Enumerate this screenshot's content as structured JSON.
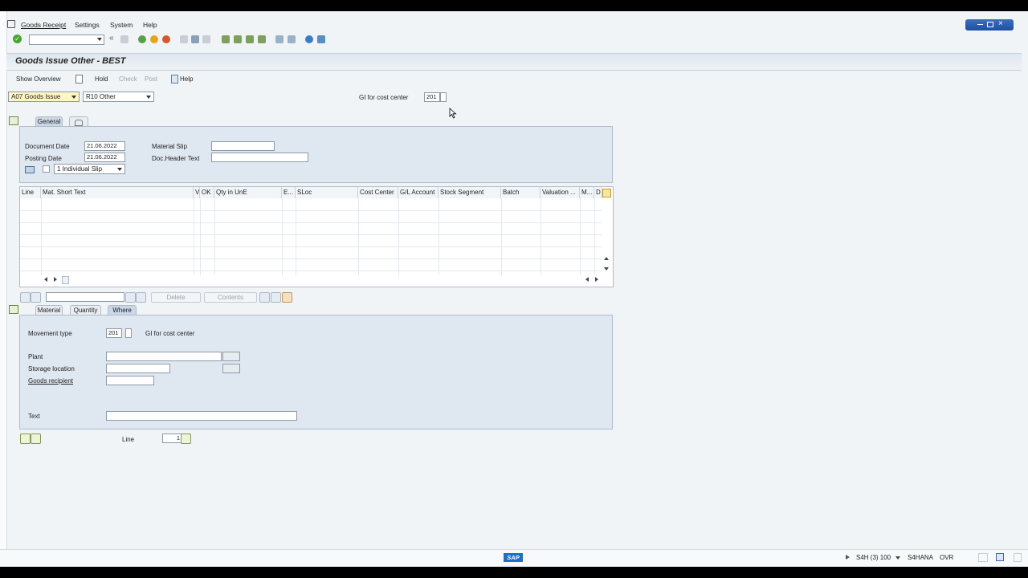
{
  "menu": {
    "items": [
      "Goods Receipt",
      "Settings",
      "System",
      "Help"
    ]
  },
  "title": "Goods Issue Other - BEST",
  "app_toolbar": {
    "show_overview": "Show Overview",
    "hold": "Hold",
    "check": "Check",
    "post": "Post",
    "help": "Help"
  },
  "header": {
    "action": "A07 Goods Issue",
    "reference": "R10 Other",
    "movement_label": "GI for cost center",
    "movement_value": "201"
  },
  "tabs_top": [
    "General"
  ],
  "general": {
    "document_date_label": "Document Date",
    "document_date": "21.06.2022",
    "posting_date_label": "Posting Date",
    "posting_date": "21.06.2022",
    "material_slip_label": "Material Slip",
    "doc_header_label": "Doc.Header Text",
    "slip_option": "1 Individual Slip"
  },
  "grid": {
    "columns": [
      "Line",
      "Mat. Short Text",
      "V",
      "OK",
      "Qty in UnE",
      "E...",
      "SLoc",
      "Cost Center",
      "G/L Account",
      "Stock Segment",
      "Batch",
      "Valuation ...",
      "M...",
      "D"
    ]
  },
  "grid_toolbar": {
    "delete": "Delete",
    "contents": "Contents"
  },
  "tabs_bottom": [
    "Material",
    "Quantity",
    "Where"
  ],
  "where": {
    "movement_type_label": "Movement type",
    "movement_type_value": "201",
    "movement_type_text": "GI for cost center",
    "plant_label": "Plant",
    "storage_label": "Storage location",
    "recipient_label": "Goods recipient",
    "text_label": "Text"
  },
  "footer": {
    "line_label": "Line",
    "line_value": "1"
  },
  "status": {
    "logo": "SAP",
    "system": "S4H (3) 100",
    "host": "S4HANA",
    "mode": "OVR"
  }
}
